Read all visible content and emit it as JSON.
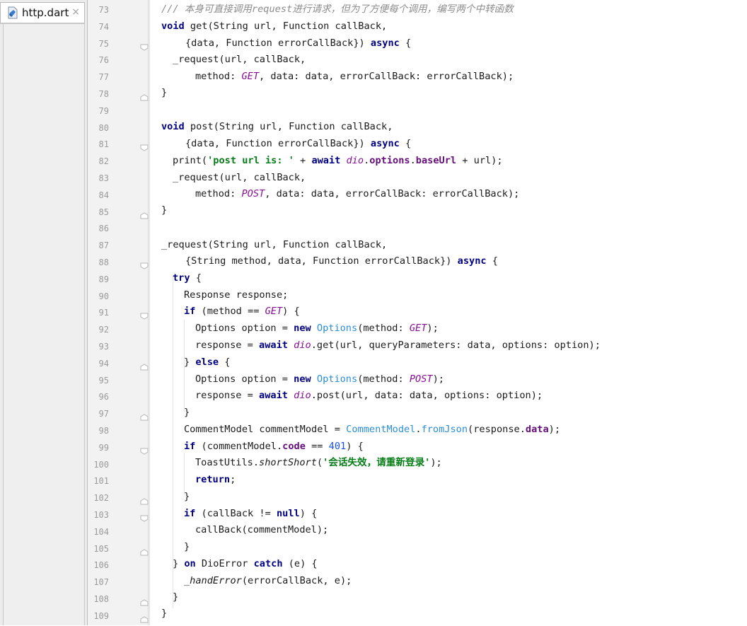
{
  "editor_tab": {
    "file_name": "http.dart",
    "close_glyph": "×"
  },
  "line_numbers": [
    "73",
    "74",
    "75",
    "76",
    "77",
    "78",
    "79",
    "80",
    "81",
    "82",
    "83",
    "84",
    "85",
    "86",
    "87",
    "88",
    "89",
    "90",
    "91",
    "92",
    "93",
    "94",
    "95",
    "96",
    "97",
    "98",
    "99",
    "100",
    "101",
    "102",
    "103",
    "104",
    "105",
    "106",
    "107",
    "108",
    "109"
  ],
  "code": {
    "l73": {
      "comment_prefix": "/// 本身可直接调用",
      "comment_ital": "request",
      "comment_suffix": "进行请求，但为了方便每个调用，编写两个中转函数"
    },
    "l74": {
      "kw": "void",
      "rest": " get(String url, Function callBack,"
    },
    "l75": {
      "a": "{data, Function errorCallBack}) ",
      "kw": "async",
      "b": " {"
    },
    "l76": {
      "text": "_request(url, callBack,"
    },
    "l77": {
      "a": "method: ",
      "const": "GET",
      "b": ", data: data, errorCallBack: errorCallBack);"
    },
    "l78": {
      "text": "}"
    },
    "l80": {
      "kw": "void",
      "rest": " post(String url, Function callBack,"
    },
    "l81": {
      "a": "{data, Function errorCallBack}) ",
      "kw": "async",
      "b": " {"
    },
    "l82": {
      "a": "print(",
      "str": "'post url is: '",
      "b": " + ",
      "kw": "await",
      "c": " ",
      "dio": "dio",
      "d": ".",
      "f1": "options",
      "e": ".",
      "f2": "baseUrl",
      "g": " + url);"
    },
    "l83": {
      "text": "_request(url, callBack,"
    },
    "l84": {
      "a": "method: ",
      "const": "POST",
      "b": ", data: data, errorCallBack: errorCallBack);"
    },
    "l85": {
      "text": "}"
    },
    "l87": {
      "text": "_request(String url, Function callBack,"
    },
    "l88": {
      "a": "{String method, data, Function errorCallBack}) ",
      "kw": "async",
      "b": " {"
    },
    "l89": {
      "kw": "try",
      "b": " {"
    },
    "l90": {
      "text": "Response response;"
    },
    "l91": {
      "kw": "if",
      "a": " (method == ",
      "const": "GET",
      "b": ") {"
    },
    "l92": {
      "a": "Options option = ",
      "kw": "new",
      "c": " ",
      "cls": "Options",
      "d": "(method: ",
      "const": "GET",
      "e": ");"
    },
    "l93": {
      "a": "response = ",
      "kw": "await",
      "c": " ",
      "dio": "dio",
      "d": ".get(url, queryParameters: data, options: option);"
    },
    "l94": {
      "a": "} ",
      "kw": "else",
      "b": " {"
    },
    "l95": {
      "a": "Options option = ",
      "kw": "new",
      "c": " ",
      "cls": "Options",
      "d": "(method: ",
      "const": "POST",
      "e": ");"
    },
    "l96": {
      "a": "response = ",
      "kw": "await",
      "c": " ",
      "dio": "dio",
      "d": ".post(url, data: data, options: option);"
    },
    "l97": {
      "text": "}"
    },
    "l98": {
      "a": "CommentModel commentModel = ",
      "cls1": "CommentModel",
      "d": ".",
      "cls2": "fromJson",
      "e": "(response.",
      "fld": "data",
      "f": ");"
    },
    "l99": {
      "kw": "if",
      "a": " (commentModel.",
      "fld": "code",
      "b": " == ",
      "num": "401",
      "c": ") {"
    },
    "l100": {
      "a": "ToastUtils.",
      "it": "shortShort",
      "b": "(",
      "str": "'会话失效，请重新登录'",
      "c": ");"
    },
    "l101": {
      "kw": "return",
      "b": ";"
    },
    "l102": {
      "text": "}"
    },
    "l103": {
      "kw": "if",
      "a": " (callBack != ",
      "kw2": "null",
      "b": ") {"
    },
    "l104": {
      "text": "callBack(commentModel);"
    },
    "l105": {
      "text": "}"
    },
    "l106": {
      "a": "} ",
      "kw": "on",
      "b": " DioError ",
      "kw2": "catch",
      "c": " (e) {"
    },
    "l107": {
      "it": "_handError",
      "b": "(errorCallBack, e);"
    },
    "l108": {
      "text": "}"
    },
    "l109": {
      "text": "}"
    }
  },
  "colors": {
    "keyword": "#000080",
    "string": "#067d17",
    "constant": "#871094",
    "field": "#660e7a",
    "class_ref": "#2a8fd6",
    "number": "#1750eb",
    "comment": "#8c8c8c"
  }
}
